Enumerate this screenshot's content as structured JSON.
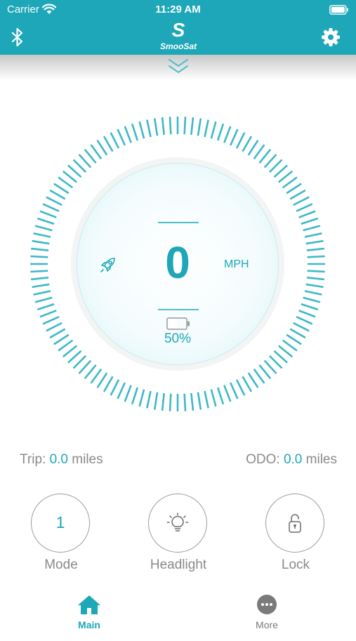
{
  "status_bar": {
    "carrier": "Carrier",
    "time": "11:29 AM"
  },
  "header": {
    "logo_mark": "S",
    "logo_text": "SmooSat"
  },
  "gauge": {
    "speed": "0",
    "unit": "MPH",
    "battery_percent": "50%",
    "battery_level": 0.5
  },
  "stats": {
    "trip_label": "Trip:",
    "trip_value": "0.0",
    "trip_unit": "miles",
    "odo_label": "ODO:",
    "odo_value": "0.0",
    "odo_unit": "miles"
  },
  "controls": {
    "mode_value": "1",
    "mode_label": "Mode",
    "headlight_label": "Headlight",
    "lock_label": "Lock"
  },
  "tabs": [
    {
      "label": "Main"
    },
    {
      "label": "More"
    }
  ],
  "colors": {
    "accent": "#1da7b8",
    "tick_color": "#3db8c7",
    "text_gray": "#8a8a8a"
  }
}
